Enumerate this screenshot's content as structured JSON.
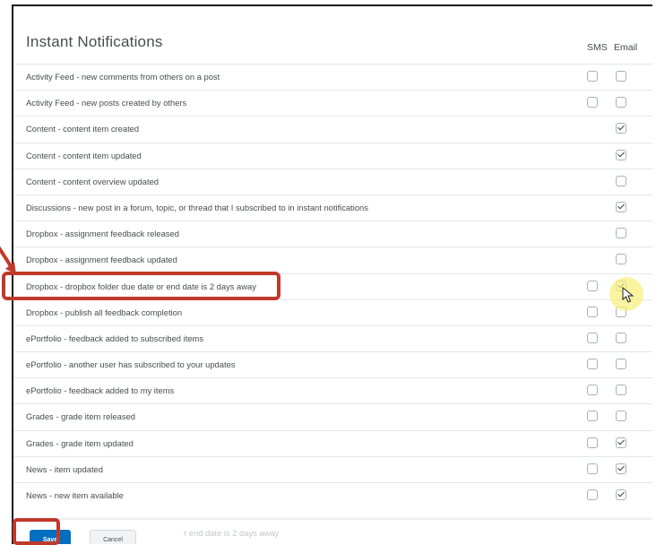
{
  "header": {
    "title": "Instant Notifications",
    "col_sms": "SMS",
    "col_email": "Email"
  },
  "rows": [
    {
      "label": "Activity Feed - new comments from others on a post",
      "sms": "unchecked",
      "email": "unchecked"
    },
    {
      "label": "Activity Feed - new posts created by others",
      "sms": "unchecked",
      "email": "unchecked"
    },
    {
      "label": "Content - content item created",
      "sms": "none",
      "email": "checked"
    },
    {
      "label": "Content - content item updated",
      "sms": "none",
      "email": "checked"
    },
    {
      "label": "Content - content overview updated",
      "sms": "none",
      "email": "unchecked"
    },
    {
      "label": "Discussions - new post in a forum, topic, or thread that I subscribed to in instant notifications",
      "sms": "none",
      "email": "checked"
    },
    {
      "label": "Dropbox - assignment feedback released",
      "sms": "none",
      "email": "unchecked"
    },
    {
      "label": "Dropbox - assignment feedback updated",
      "sms": "none",
      "email": "unchecked"
    },
    {
      "label": "Dropbox - dropbox folder due date or end date is 2 days away",
      "sms": "unchecked",
      "email": "checked"
    },
    {
      "label": "Dropbox - publish all feedback completion",
      "sms": "unchecked",
      "email": "unchecked"
    },
    {
      "label": "ePortfolio - feedback added to subscribed items",
      "sms": "unchecked",
      "email": "unchecked"
    },
    {
      "label": "ePortfolio - another user has subscribed to your updates",
      "sms": "unchecked",
      "email": "unchecked"
    },
    {
      "label": "ePortfolio - feedback added to my items",
      "sms": "unchecked",
      "email": "unchecked"
    },
    {
      "label": "Grades - grade item released",
      "sms": "unchecked",
      "email": "unchecked"
    },
    {
      "label": "Grades - grade item updated",
      "sms": "unchecked",
      "email": "checked"
    },
    {
      "label": "News - item updated",
      "sms": "unchecked",
      "email": "checked"
    },
    {
      "label": "News - new item available",
      "sms": "unchecked",
      "email": "checked"
    }
  ],
  "footer": {
    "faded_row_text": "r end date is 2 days away",
    "save_label": "Save",
    "cancel_label": "Cancel"
  },
  "colors": {
    "highlight": "#c0392b",
    "primary_button": "#006fbf"
  }
}
